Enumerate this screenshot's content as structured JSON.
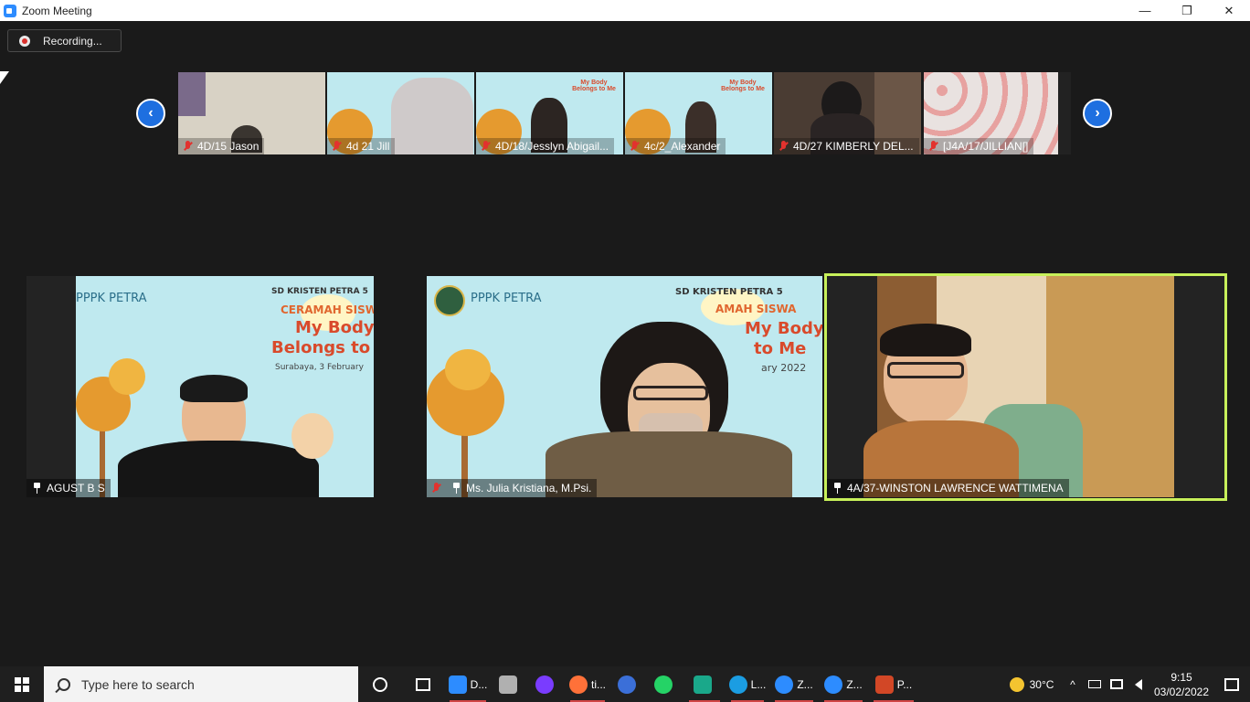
{
  "window": {
    "title": "Zoom Meeting"
  },
  "controls": {
    "minimize": "—",
    "restore": "❐",
    "close": "✕"
  },
  "recording": {
    "label": "Recording..."
  },
  "gallery": {
    "prev_arrow": "‹",
    "next_arrow": "›",
    "thumbnails": [
      {
        "name": "4D/15 Jason"
      },
      {
        "name": "4d 21 Jill"
      },
      {
        "name": "4D/18/Jesslyn Abigail..."
      },
      {
        "name": "4c/2_Alexander"
      },
      {
        "name": "4D/27 KIMBERLY DEL..."
      },
      {
        "name": "[J4A/17/JILLIAN[]"
      }
    ]
  },
  "main_tiles": [
    {
      "name": "AGUST B S"
    },
    {
      "name": "Ms. Julia Kristiana, M.Psi."
    },
    {
      "name": "4A/37-WINSTON LAWRENCE WATTIMENA"
    }
  ],
  "slide": {
    "org": "PPPK PETRA",
    "school": "SD KRISTEN PETRA 5",
    "event": "CERAMAH SISWA",
    "title_line1": "My Body",
    "title_line2": "Belongs to Me",
    "title_partial_1": "Belongs to",
    "event_partial": "AMAH SISWA",
    "title_partial_2": "to Me",
    "place_date": "Surabaya, 3 February",
    "date_partial": "ary 2022"
  },
  "taskbar": {
    "search_placeholder": "Type here to search",
    "apps": [
      {
        "label": "D...",
        "icon": "download-icon",
        "color": "#2d8cff"
      },
      {
        "label": "",
        "icon": "settings-icon",
        "color": "#b0b0b0"
      },
      {
        "label": "",
        "icon": "audio-icon",
        "color": "#7a3cff"
      },
      {
        "label": "ti...",
        "icon": "firefox-icon",
        "color": "#ff7139"
      },
      {
        "label": "",
        "icon": "globe-icon",
        "color": "#3b6fd8"
      },
      {
        "label": "",
        "icon": "whatsapp-icon",
        "color": "#25d366"
      },
      {
        "label": "",
        "icon": "filmora-icon",
        "color": "#1aa88a"
      },
      {
        "label": "L...",
        "icon": "edge-icon",
        "color": "#1b9de2"
      },
      {
        "label": "Z...",
        "icon": "zoom-icon",
        "color": "#2d8cff"
      },
      {
        "label": "Z...",
        "icon": "zoom-icon",
        "color": "#2d8cff"
      },
      {
        "label": "P...",
        "icon": "powerpoint-icon",
        "color": "#d24726"
      }
    ],
    "weather": "30°C",
    "time": "9:15",
    "date": "03/02/2022"
  }
}
